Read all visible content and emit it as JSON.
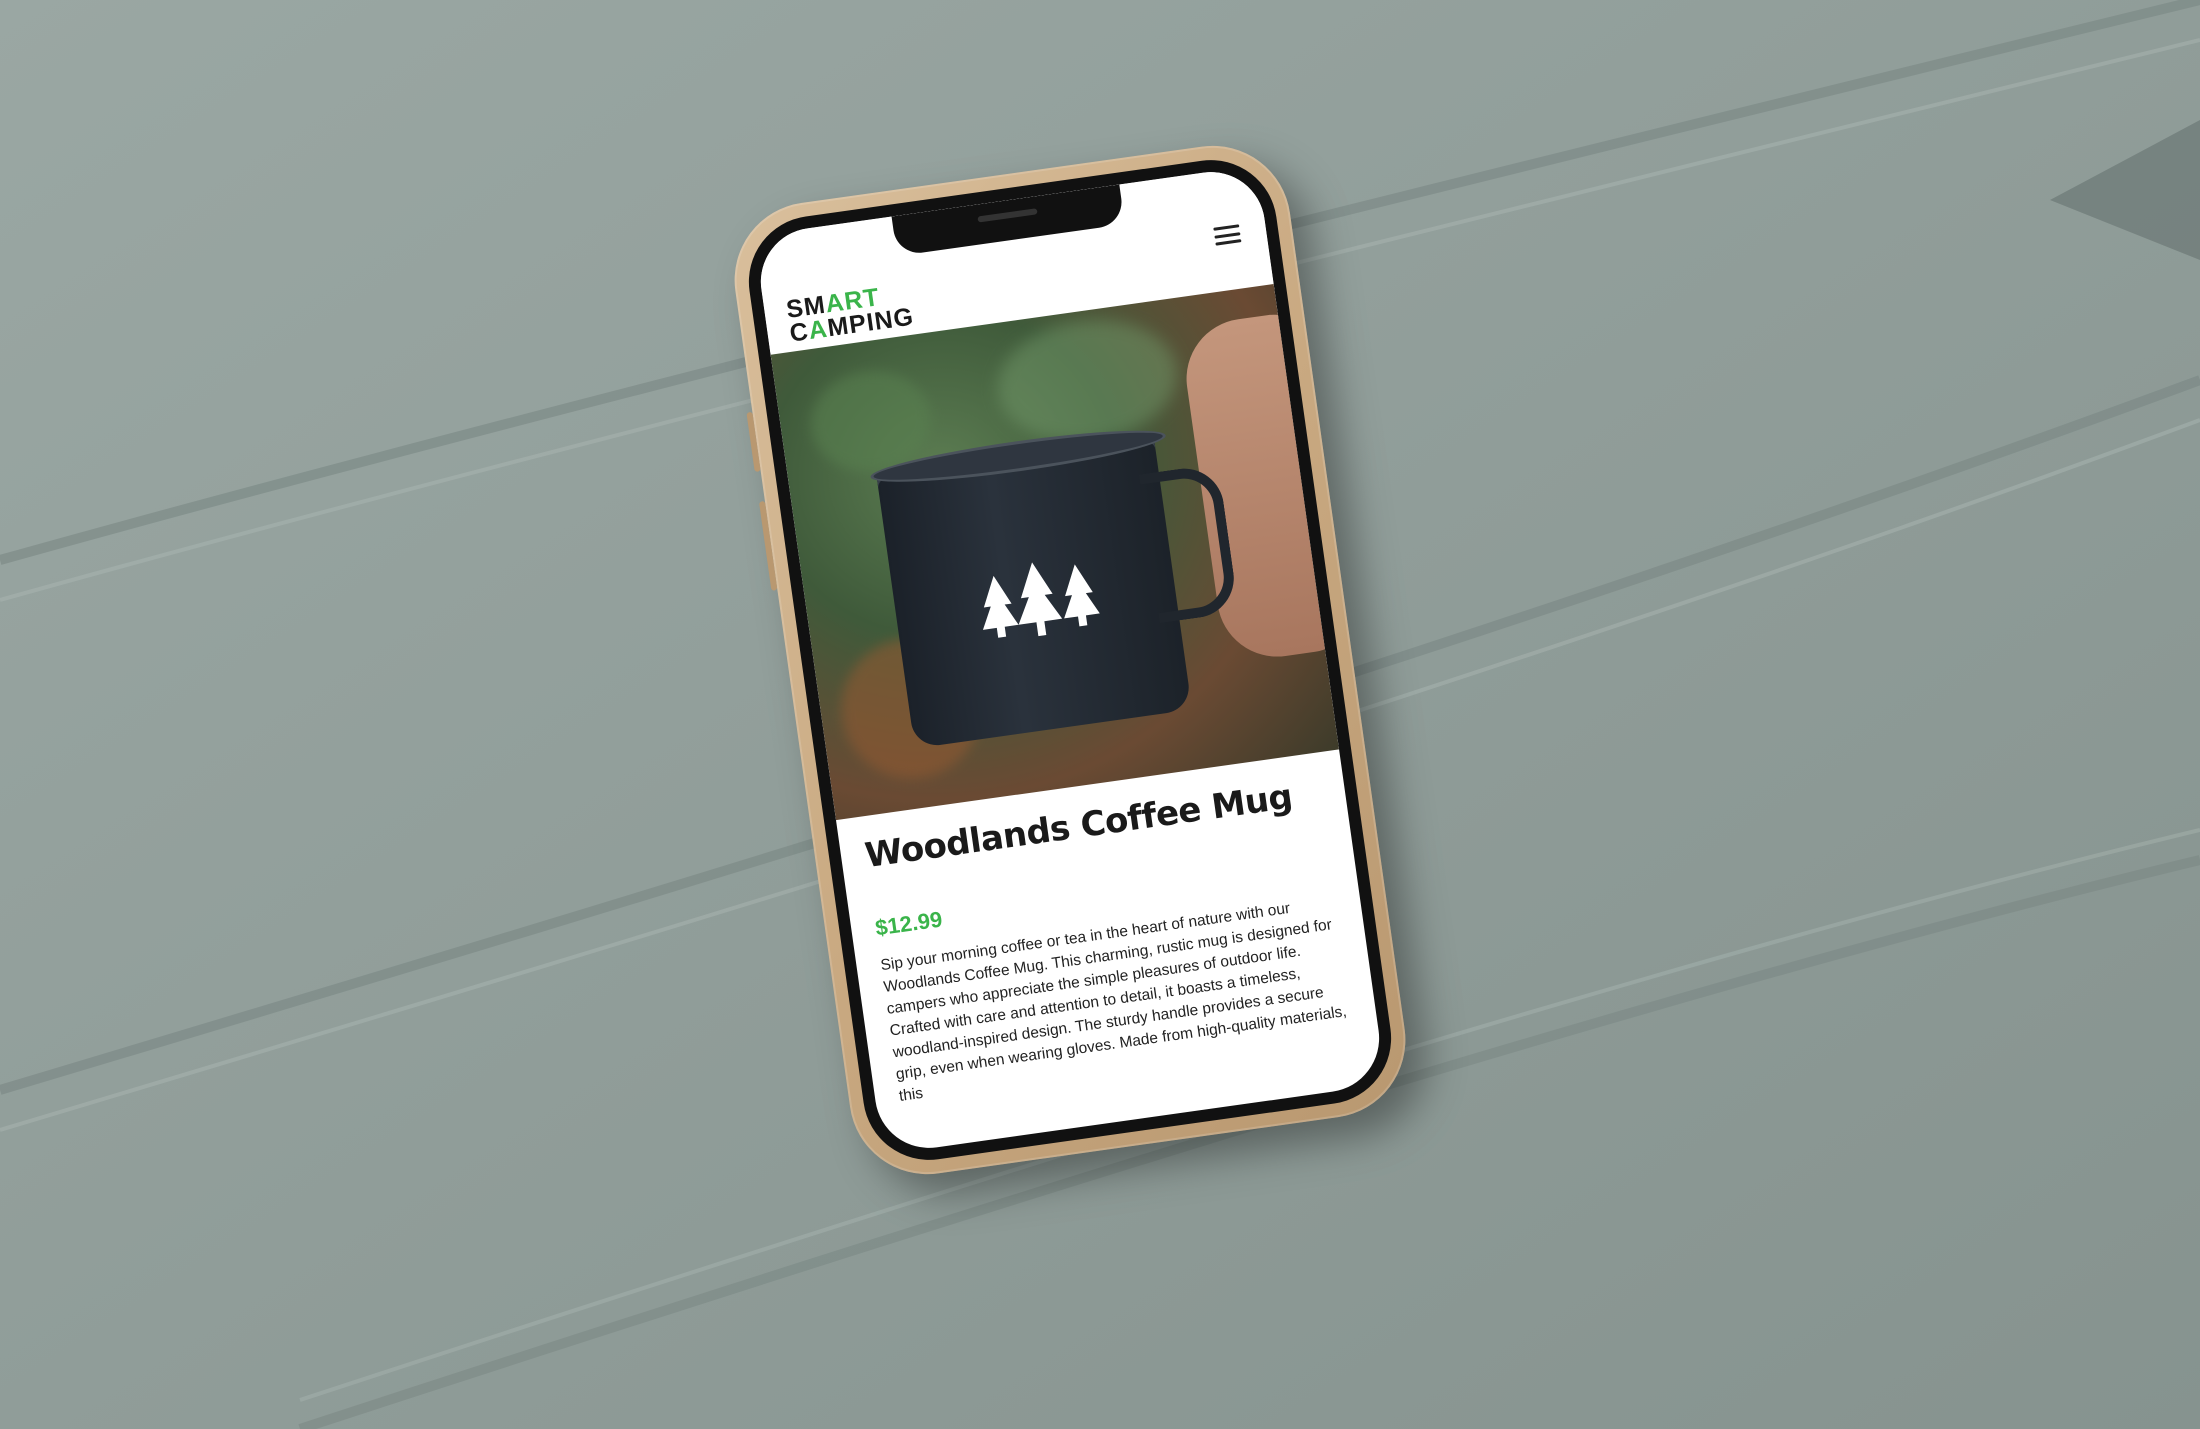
{
  "site": {
    "logo_line1_part1": "SM",
    "logo_line1_part2": "ART",
    "logo_line2_part1": "C",
    "logo_line2_part2": "A",
    "logo_line2_part3": "MPING"
  },
  "product": {
    "title": "Woodlands Coffee Mug",
    "price": "$12.99",
    "description": "Sip your morning coffee or tea in the heart of nature with our Woodlands Coffee Mug. This charming, rustic mug is designed for campers who appreciate the simple pleasures of outdoor life. Crafted with care and attention to detail, it boasts a timeless, woodland-inspired design. The sturdy handle provides a secure grip, even when wearing gloves. Made from high-quality materials, this"
  },
  "colors": {
    "accent_green": "#3ab44a",
    "fabric": "#8f9c98",
    "phone_case": "#c9a981"
  },
  "icons": {
    "menu": "hamburger-menu-icon"
  }
}
